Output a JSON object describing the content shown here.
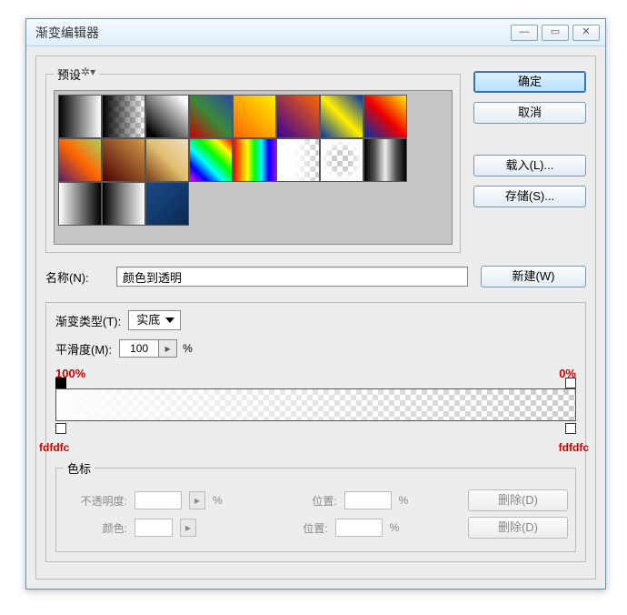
{
  "window": {
    "title": "渐变编辑器"
  },
  "presets": {
    "legend": "预设"
  },
  "buttons": {
    "ok": "确定",
    "cancel": "取消",
    "load": "载入(L)...",
    "save": "存储(S)...",
    "new": "新建(W)",
    "delete": "删除(D)"
  },
  "name": {
    "label": "名称(N):",
    "value": "颜色到透明"
  },
  "gradient": {
    "typeLabel": "渐变类型(T):",
    "typeValue": "实底",
    "smoothLabel": "平滑度(M):",
    "smoothValue": "100",
    "smoothUnit": "%"
  },
  "annotations": {
    "leftOpacity": "100%",
    "rightOpacity": "0%",
    "leftColor": "fdfdfc",
    "rightColor": "fdfdfc"
  },
  "stops": {
    "legend": "色标",
    "opacityLabel": "不透明度:",
    "positionLabel": "位置:",
    "colorLabel": "颜色:",
    "pct": "%"
  }
}
